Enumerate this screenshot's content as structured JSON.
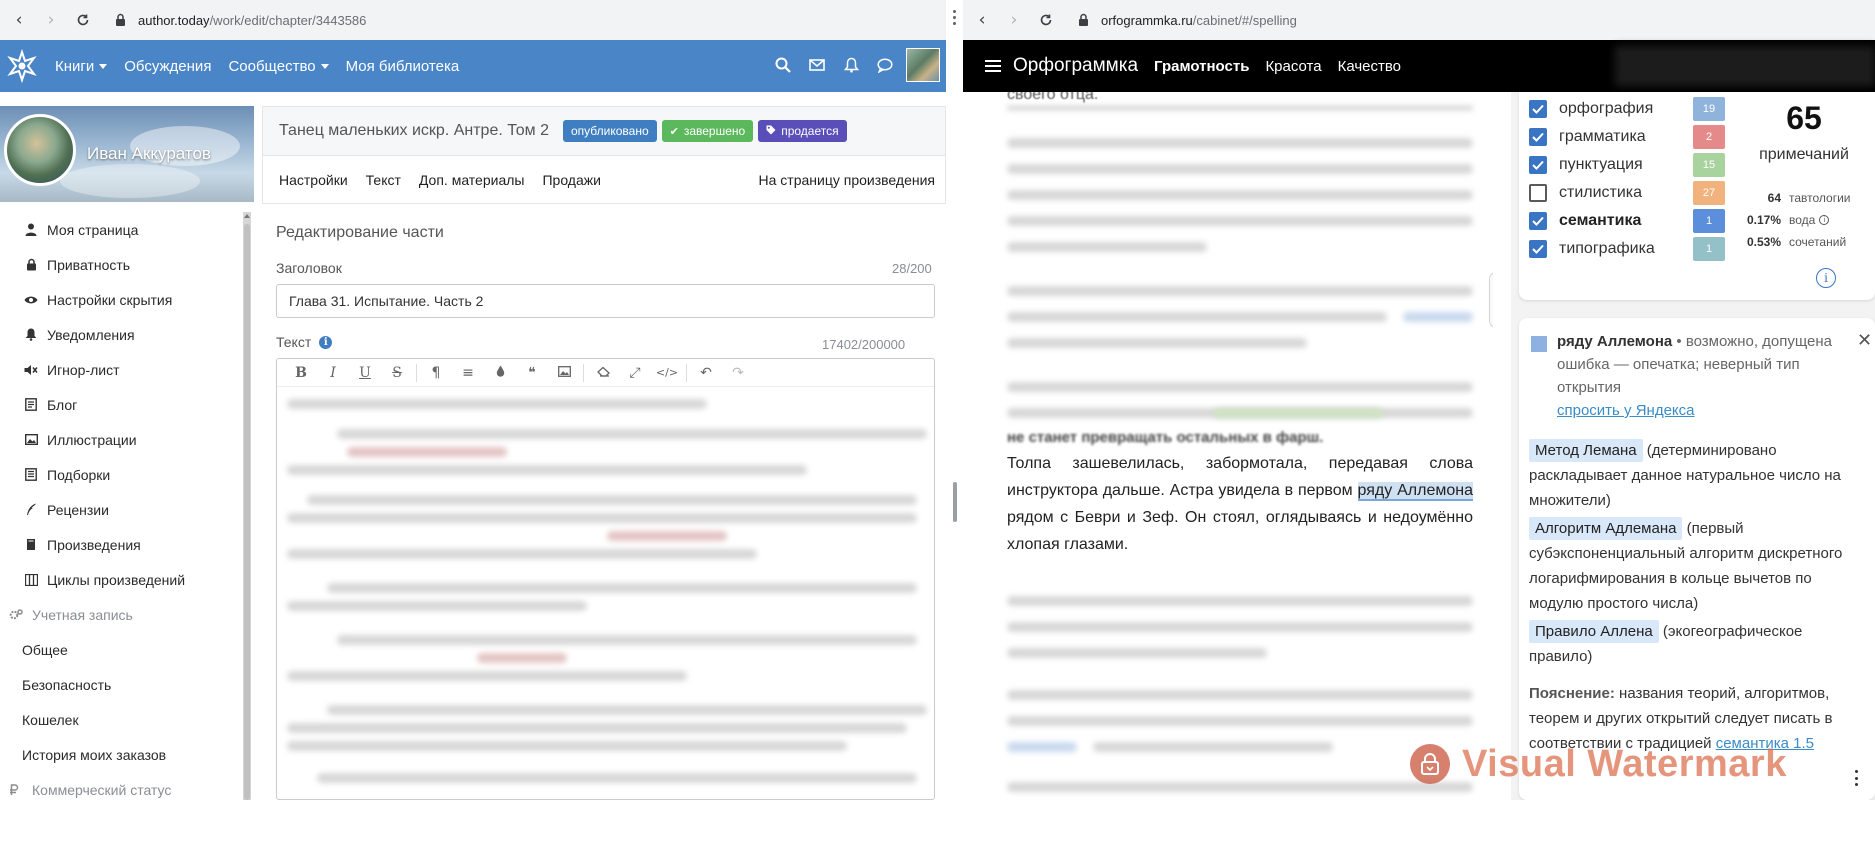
{
  "left_window": {
    "address": {
      "host": "author.today",
      "path": "/work/edit/chapter/3443586"
    },
    "header": {
      "menu": [
        {
          "label": "Книги",
          "has_caret": true
        },
        {
          "label": "Обсуждения",
          "has_caret": false
        },
        {
          "label": "Сообщество",
          "has_caret": true
        },
        {
          "label": "Моя библиотека",
          "has_caret": false
        }
      ]
    },
    "profile": {
      "name": "Иван Аккуратов"
    },
    "sidebar": {
      "items": [
        {
          "label": "Моя страница",
          "icon": "user-icon"
        },
        {
          "label": "Приватность",
          "icon": "lock-icon"
        },
        {
          "label": "Настройки скрытия",
          "icon": "eye-icon"
        },
        {
          "label": "Уведомления",
          "icon": "bell-icon"
        },
        {
          "label": "Игнор-лист",
          "icon": "mute-icon"
        },
        {
          "label": "Блог",
          "icon": "blog-icon"
        },
        {
          "label": "Иллюстрации",
          "icon": "image-icon"
        },
        {
          "label": "Подборки",
          "icon": "collection-icon"
        },
        {
          "label": "Рецензии",
          "icon": "quill-icon"
        },
        {
          "label": "Произведения",
          "icon": "book-icon"
        },
        {
          "label": "Циклы произведений",
          "icon": "series-icon"
        }
      ],
      "account_section": "Учетная запись",
      "account_items": [
        "Общее",
        "Безопасность",
        "Кошелек",
        "История моих заказов"
      ],
      "commercial_section": "Коммерческий статус"
    },
    "work": {
      "title": "Танец маленьких искр. Антре. Том 2",
      "badges": {
        "published": "опубликовано",
        "finished": "завершено",
        "selling": "продается"
      }
    },
    "tabs": [
      "Настройки",
      "Текст",
      "Доп. материалы",
      "Продажи"
    ],
    "tab_right": "На страницу произведения",
    "edit_title": "Редактирование части",
    "heading_label": "Заголовок",
    "heading_counter": "28/200",
    "heading_value": "Глава 31. Испытание. Часть 2",
    "text_label": "Текст",
    "text_counter": "17402/200000"
  },
  "right_window": {
    "address": {
      "host": "orfogrammka.ru",
      "path": "/cabinet/#/spelling"
    },
    "header": {
      "brand": "Орфограммка",
      "nav": [
        {
          "label": "Грамотность",
          "active": true
        },
        {
          "label": "Красота",
          "active": false
        },
        {
          "label": "Качество",
          "active": false
        }
      ]
    },
    "doc": {
      "top_fragment": "своего отца.",
      "line_partial": "не станет превращать остальных в фарш.",
      "before": "Толпа зашевелилась, забормотала, передавая слова инструктора дальше. Астра увидела в первом ",
      "highlight": "ряду Аллемона",
      "after": " рядом с Беври и Зеф. Он стоял, оглядываясь и недоумённо хлопая глазами."
    },
    "categories": [
      {
        "label": "орфография",
        "count": "19",
        "color": "#8fb3da",
        "checked": true,
        "bold": false
      },
      {
        "label": "грамматика",
        "count": "2",
        "color": "#e58a8a",
        "checked": true,
        "bold": false
      },
      {
        "label": "пунктуация",
        "count": "15",
        "color": "#a9d39e",
        "checked": true,
        "bold": false
      },
      {
        "label": "стилистика",
        "count": "27",
        "color": "#f2b27e",
        "checked": false,
        "bold": false
      },
      {
        "label": "семантика",
        "count": "1",
        "color": "#5b8fdc",
        "checked": true,
        "bold": true
      },
      {
        "label": "типографика",
        "count": "1",
        "color": "#94c0c8",
        "checked": true,
        "bold": false
      }
    ],
    "total": {
      "value": "65",
      "label": "примечаний"
    },
    "stats": [
      {
        "value": "64",
        "label": "тавтологии"
      },
      {
        "value": "0.17%",
        "label": "вода"
      },
      {
        "value": "0.53%",
        "label": "сочетаний"
      }
    ],
    "detail": {
      "word": "ряду Аллемона",
      "description": " • возможно, допущена ошибка — опечатка; неверный тип открытия",
      "ask_link": "спросить у Яндекса",
      "suggestions": [
        {
          "term": "Метод Лемана",
          "explanation": " (детерминировано раскладывает данное натуральное число на множители)"
        },
        {
          "term": "Алгоритм Адлемана",
          "explanation": " (первый субэкспоненциальный алгоритм дискретного логарифмирования в кольце вычетов по модулю простого числа)"
        },
        {
          "term": "Правило Аллена",
          "explanation": " (экогеографическое правило)"
        }
      ],
      "note_label": "Пояснение:",
      "note_text": " названия теорий, алгоритмов, теорем и других открытий следует писать в соответствии с традицией ",
      "note_link": "семантика 1.5"
    }
  },
  "watermark": "Visual Watermark"
}
